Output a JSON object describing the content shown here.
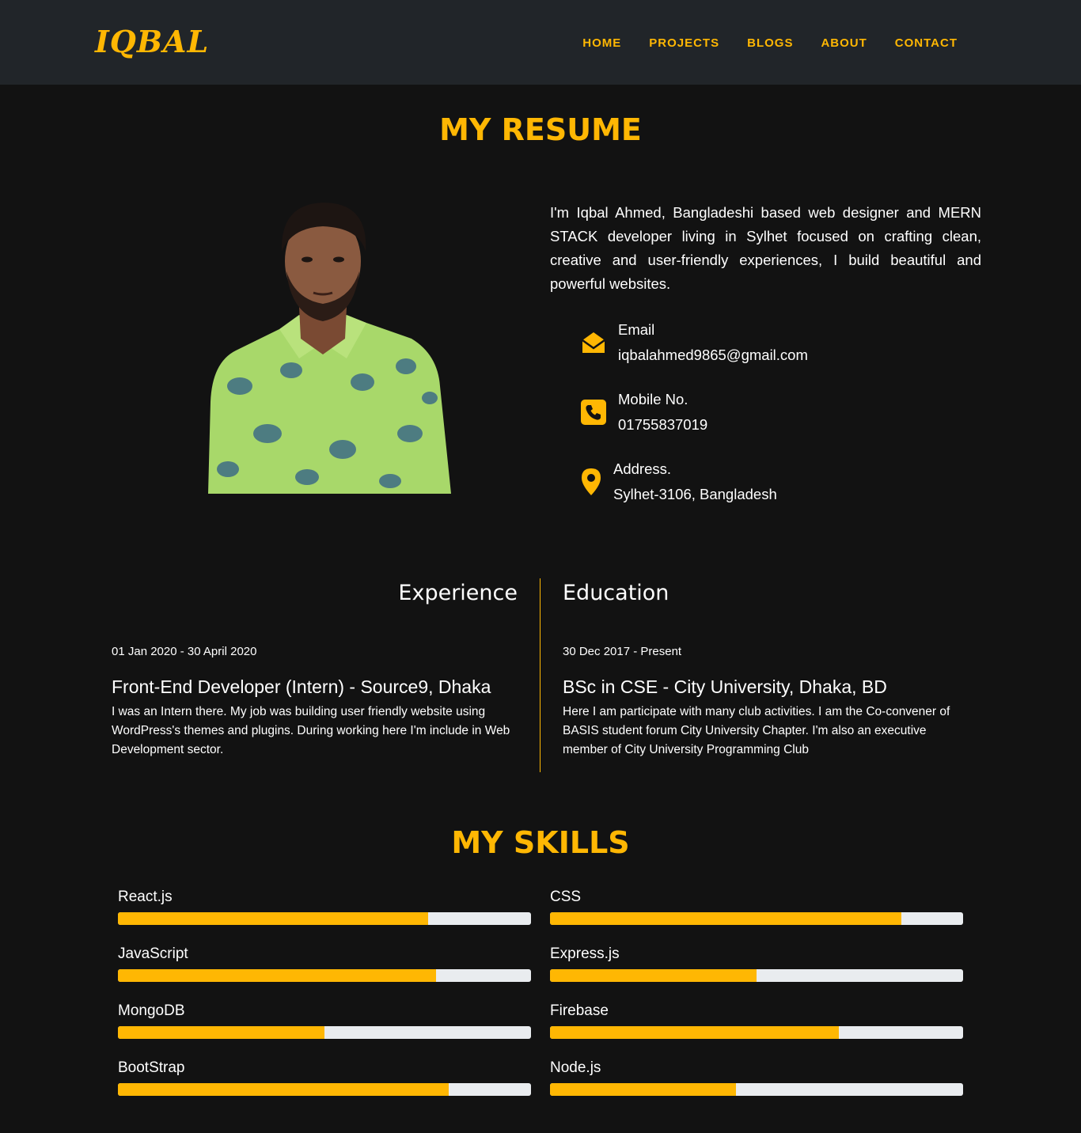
{
  "nav": {
    "brand": "IQBAL",
    "links": [
      "HOME",
      "PROJECTS",
      "BLOGS",
      "ABOUT",
      "CONTACT"
    ]
  },
  "resume": {
    "title": "MY RESUME",
    "intro": "I'm Iqbal Ahmed, Bangladeshi based web designer and MERN STACK developer living in Sylhet focused on crafting clean, creative and user-friendly experiences, I build beautiful and powerful websites.",
    "contacts": [
      {
        "icon": "envelope-open-icon",
        "label": "Email",
        "value": "iqbalahmed9865@gmail.com"
      },
      {
        "icon": "phone-icon",
        "label": "Mobile No.",
        "value": "01755837019"
      },
      {
        "icon": "map-pin-icon",
        "label": "Address.",
        "value": "Sylhet-3106, Bangladesh"
      }
    ]
  },
  "experience": {
    "heading": "Experience",
    "date": "01 Jan 2020 - 30 April 2020",
    "title": "Front-End Developer (Intern) - Source9, Dhaka",
    "description": "I was an Intern there. My job was building user friendly website using WordPress's themes and plugins. During working here I'm include in Web Development sector."
  },
  "education": {
    "heading": "Education",
    "date": "30 Dec 2017 - Present",
    "title": "BSc in CSE - City University, Dhaka, BD",
    "description": "Here I am participate with many club activities. I am the Co-convener of BASIS student forum City University Chapter. I'm also an executive member of City University Programming Club"
  },
  "skills": {
    "title": "MY SKILLS",
    "items": [
      {
        "name": "React.js",
        "percent": 75
      },
      {
        "name": "CSS",
        "percent": 85
      },
      {
        "name": "JavaScript",
        "percent": 77
      },
      {
        "name": "Express.js",
        "percent": 50
      },
      {
        "name": "MongoDB",
        "percent": 50
      },
      {
        "name": "Firebase",
        "percent": 70
      },
      {
        "name": "BootStrap",
        "percent": 80
      },
      {
        "name": "Node.js",
        "percent": 45
      }
    ]
  },
  "colors": {
    "accent": "#ffb703",
    "navbar": "#212529",
    "background": "#121212",
    "bar_track": "#e9ecef"
  }
}
